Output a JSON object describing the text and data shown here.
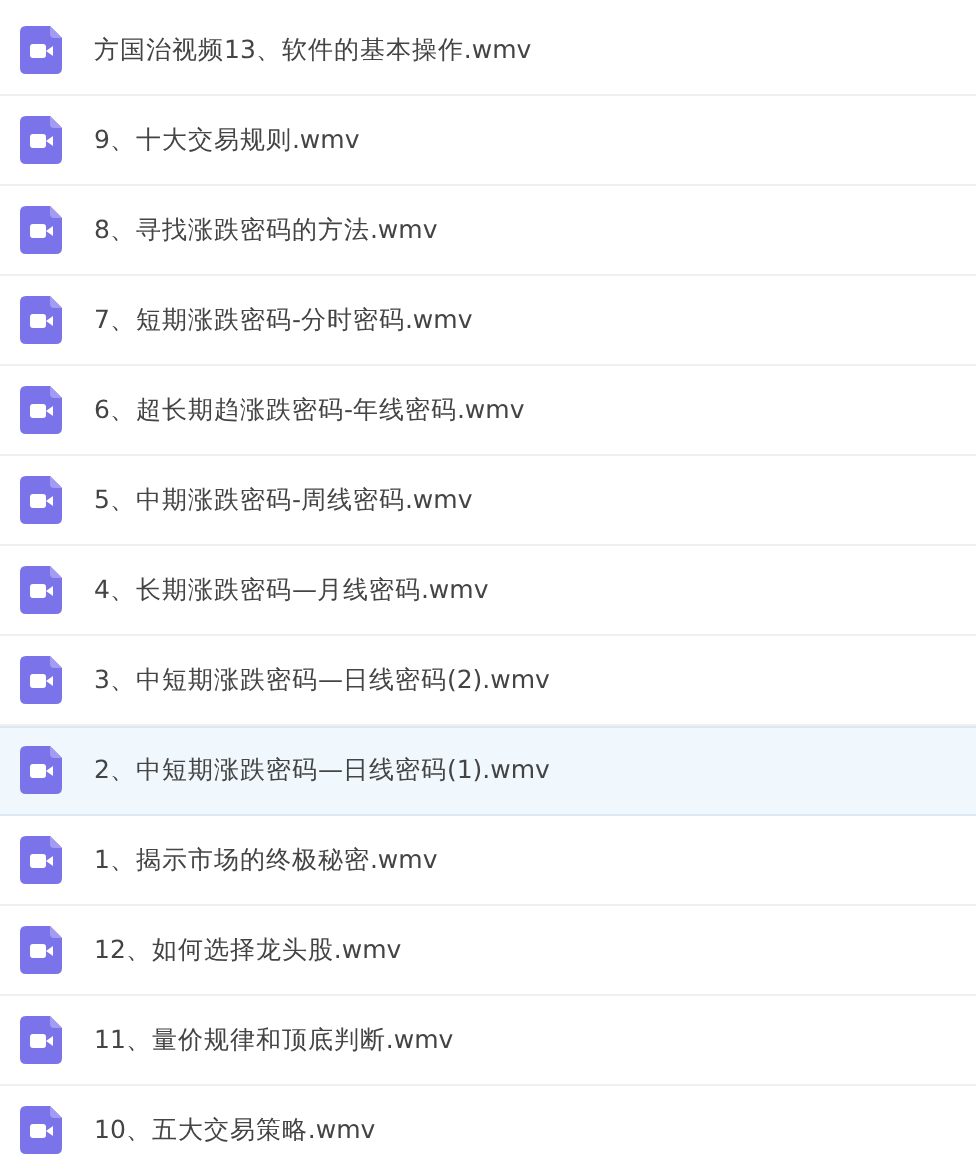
{
  "files": [
    {
      "name": "方国治视频13、软件的基本操作.wmv",
      "selected": false
    },
    {
      "name": "9、十大交易规则.wmv",
      "selected": false
    },
    {
      "name": "8、寻找涨跌密码的方法.wmv",
      "selected": false
    },
    {
      "name": "7、短期涨跌密码-分时密码.wmv",
      "selected": false
    },
    {
      "name": "6、超长期趋涨跌密码-年线密码.wmv",
      "selected": false
    },
    {
      "name": "5、中期涨跌密码-周线密码.wmv",
      "selected": false
    },
    {
      "name": "4、长期涨跌密码—月线密码.wmv",
      "selected": false
    },
    {
      "name": "3、中短期涨跌密码—日线密码(2).wmv",
      "selected": false
    },
    {
      "name": "2、中短期涨跌密码—日线密码(1).wmv",
      "selected": true
    },
    {
      "name": "1、揭示市场的终极秘密.wmv",
      "selected": false
    },
    {
      "name": "12、如何选择龙头股.wmv",
      "selected": false
    },
    {
      "name": "11、量价规律和顶底判断.wmv",
      "selected": false
    },
    {
      "name": "10、五大交易策略.wmv",
      "selected": false
    }
  ]
}
